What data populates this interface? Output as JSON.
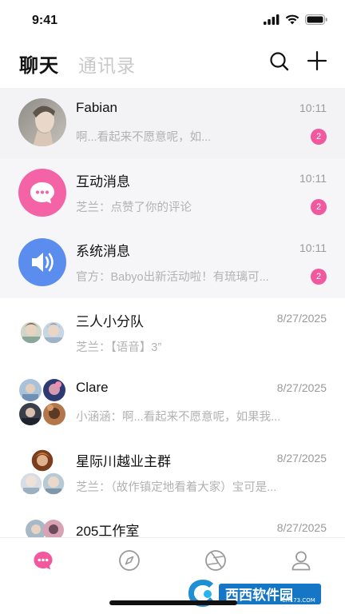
{
  "status": {
    "time": "9:41"
  },
  "header": {
    "tab_chat": "聊天",
    "tab_contacts": "通讯录"
  },
  "chats": [
    {
      "name": "Fabian",
      "preview": "啊...看起来不愿意呢，如...",
      "time": "10:11",
      "badge": "2"
    },
    {
      "name": "互动消息",
      "preview": "芝兰：点赞了你的评论",
      "time": "10:11",
      "badge": "2"
    },
    {
      "name": "系统消息",
      "preview": "官方：Babyo出新活动啦！有琉璃可...",
      "time": "10:11",
      "badge": "2"
    },
    {
      "name": "三人小分队",
      "preview": "芝兰：【语音】3”",
      "time": "8/27/2025"
    },
    {
      "name": "Clare",
      "preview": "小涵涵：啊...看起来不愿意呢，如果我...",
      "time": "8/27/2025"
    },
    {
      "name": "星际川越业主群",
      "preview": "芝兰：（故作镇定地看着大家）宝可是...",
      "time": "8/27/2025"
    },
    {
      "name": "205工作室",
      "preview": "",
      "time": "8/27/2025"
    }
  ],
  "tabbar": {
    "items": [
      "chat-icon",
      "compass-icon",
      "aperture-icon",
      "profile-icon"
    ]
  },
  "watermark": {
    "brand": "西西软件园",
    "url": "CR173.COM"
  },
  "colors": {
    "accent": "#f2589d",
    "interactive": "#f463a5",
    "system": "#5b8def"
  }
}
